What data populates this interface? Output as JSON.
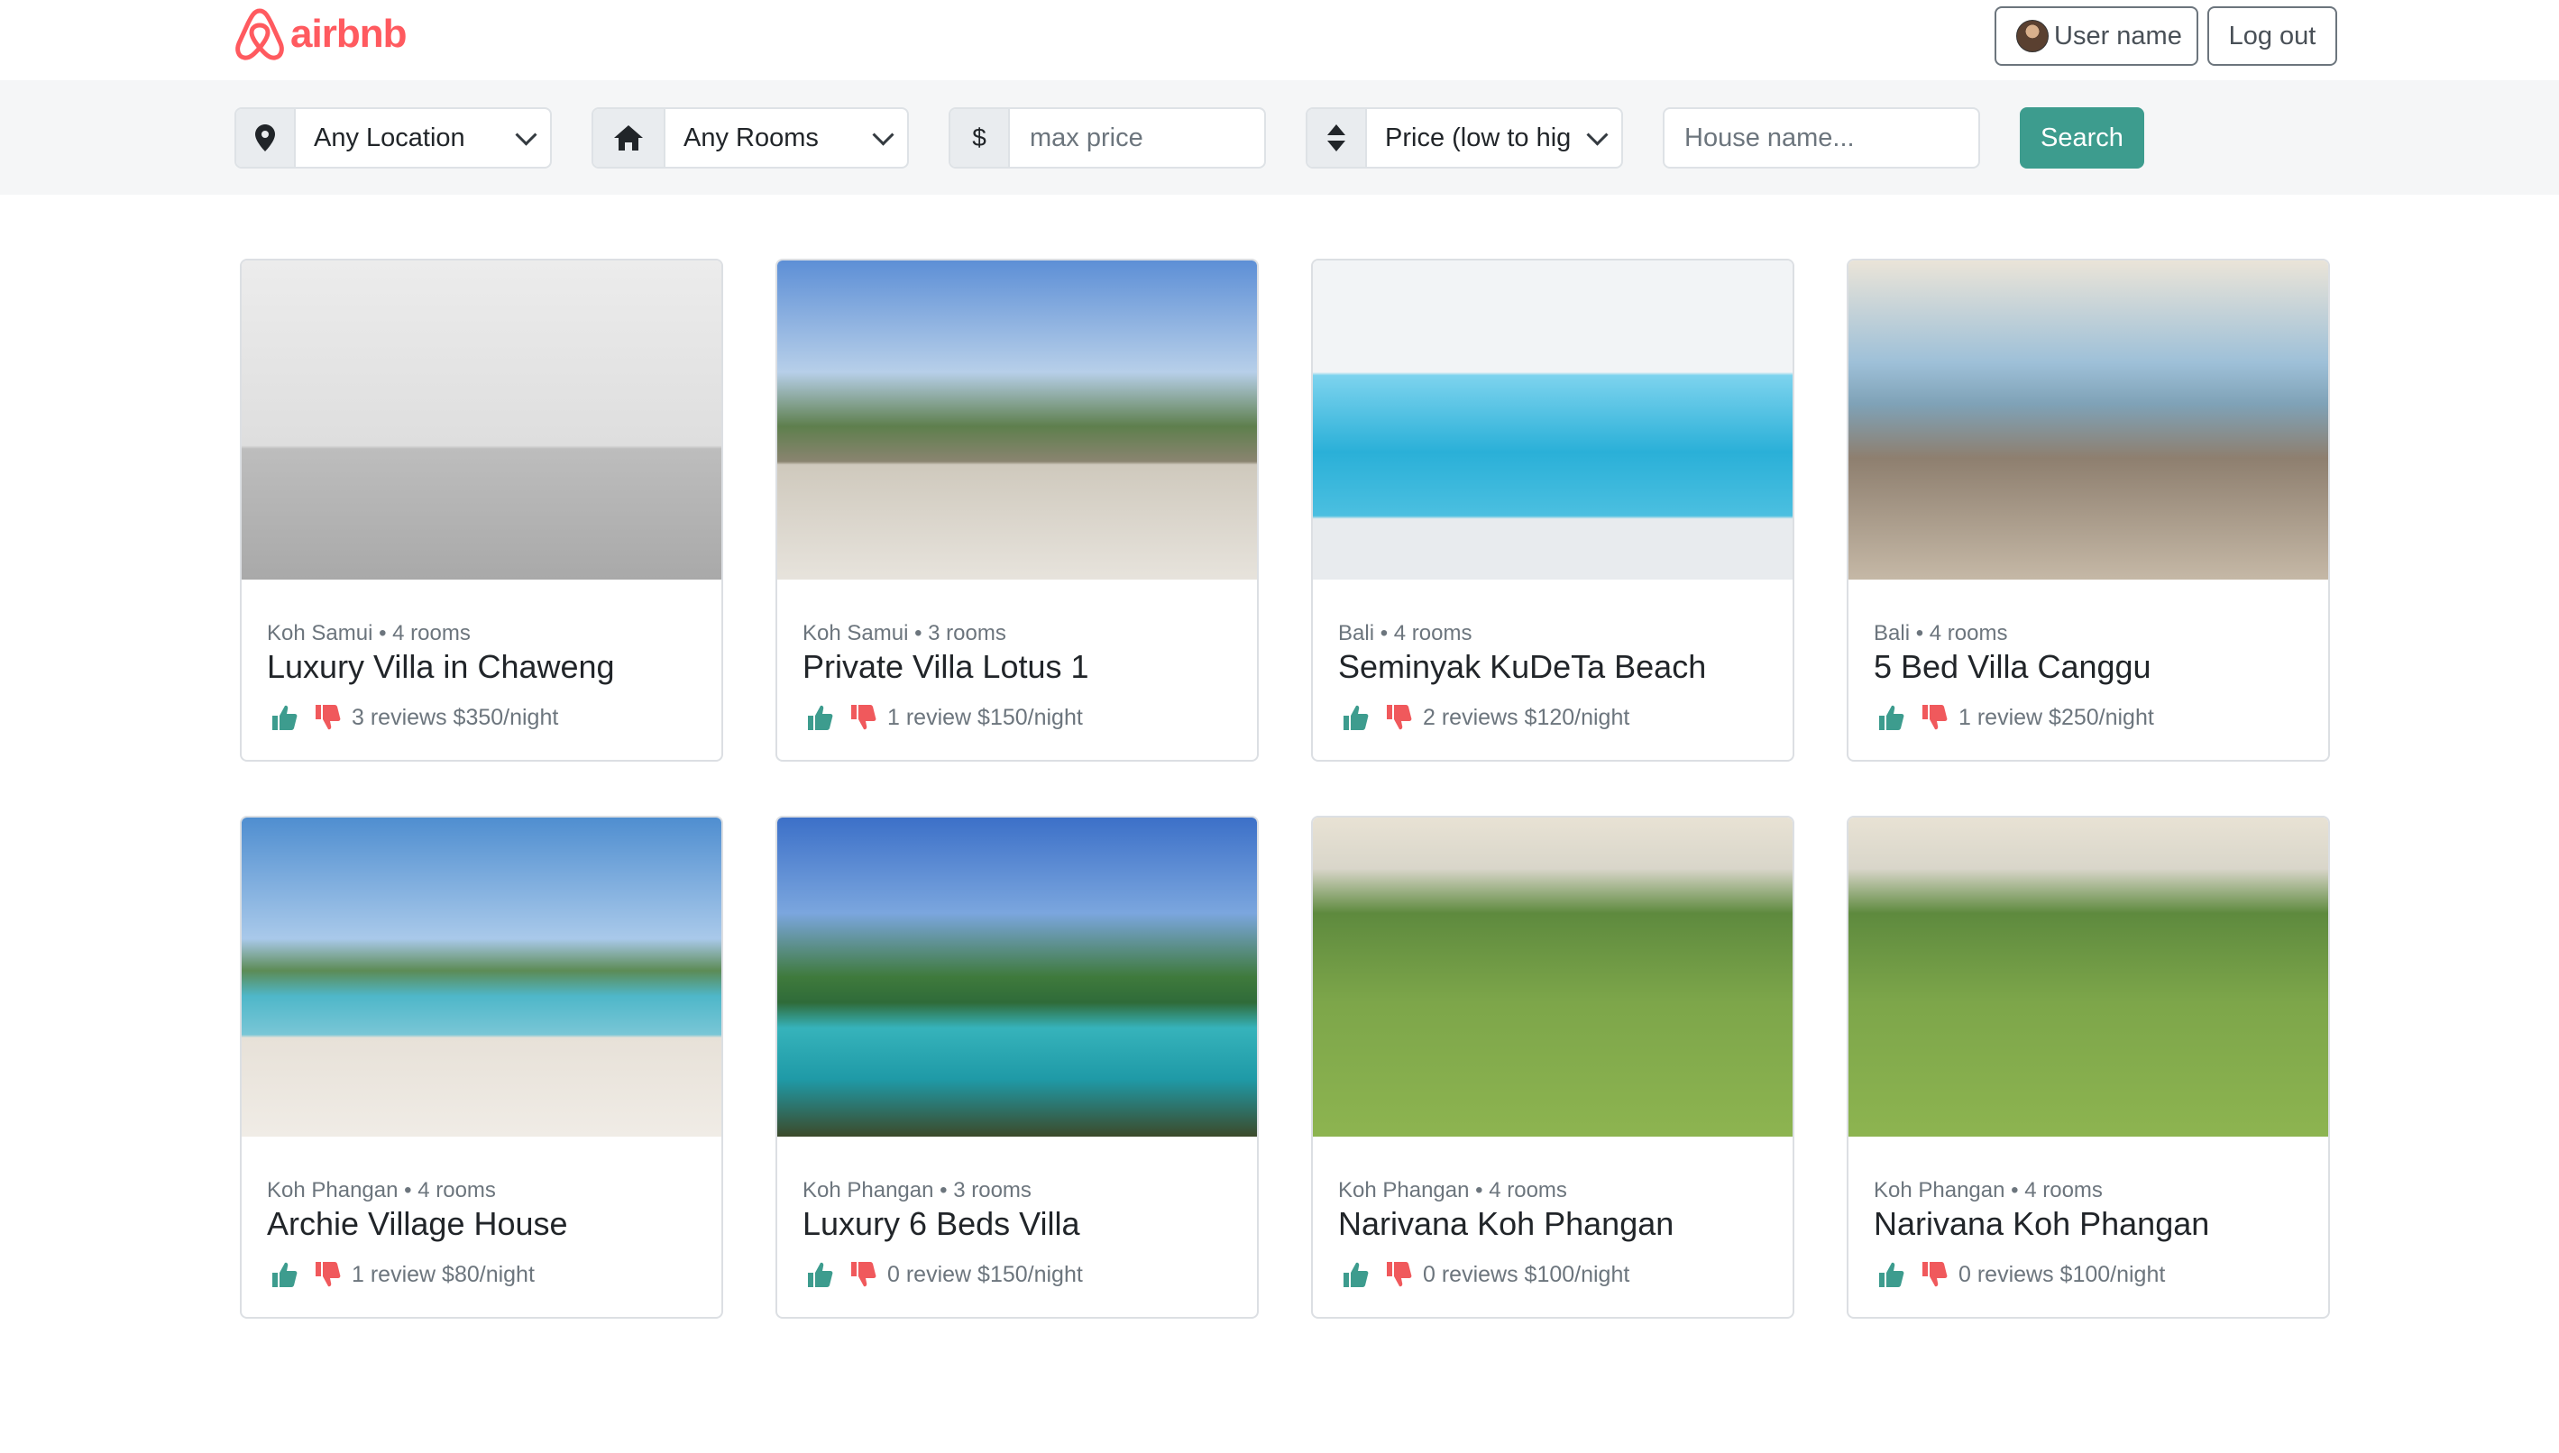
{
  "header": {
    "logo_text": "airbnb",
    "user_name": "User name",
    "logout_label": "Log out"
  },
  "filters": {
    "location": {
      "icon": "map-pin-icon",
      "value": "Any Location"
    },
    "rooms": {
      "icon": "home-icon",
      "value": "Any Rooms"
    },
    "price": {
      "addon": "$",
      "placeholder": "max price"
    },
    "sort": {
      "icon": "sort-icon",
      "value": "Price (low to hig"
    },
    "house_name_placeholder": "House name...",
    "search_label": "Search"
  },
  "colors": {
    "brand": "#ff5a5f",
    "accent": "#3d9c8e",
    "thumbs_up": "#3d9c8e",
    "thumbs_down": "#f0595c"
  },
  "listings": [
    {
      "location": "Koh Samui",
      "rooms": "4 rooms",
      "title": "Luxury Villa in Chaweng",
      "reviews_price": "3 reviews $350/night"
    },
    {
      "location": "Koh Samui",
      "rooms": "3 rooms",
      "title": "Private Villa Lotus 1",
      "reviews_price": "1 review $150/night"
    },
    {
      "location": "Bali",
      "rooms": "4 rooms",
      "title": "Seminyak KuDeTa Beach",
      "reviews_price": "2 reviews $120/night"
    },
    {
      "location": "Bali",
      "rooms": "4 rooms",
      "title": "5 Bed Villa Canggu",
      "reviews_price": "1 review $250/night"
    },
    {
      "location": "Koh Phangan",
      "rooms": "4 rooms",
      "title": "Archie Village House",
      "reviews_price": "1 review $80/night"
    },
    {
      "location": "Koh Phangan",
      "rooms": "3 rooms",
      "title": "Luxury 6 Beds Villa",
      "reviews_price": "0 review $150/night"
    },
    {
      "location": "Koh Phangan",
      "rooms": "4 rooms",
      "title": "Narivana Koh Phangan",
      "reviews_price": "0 reviews $100/night"
    },
    {
      "location": "Koh Phangan",
      "rooms": "4 rooms",
      "title": "Narivana Koh Phangan",
      "reviews_price": "0 reviews $100/night"
    }
  ]
}
